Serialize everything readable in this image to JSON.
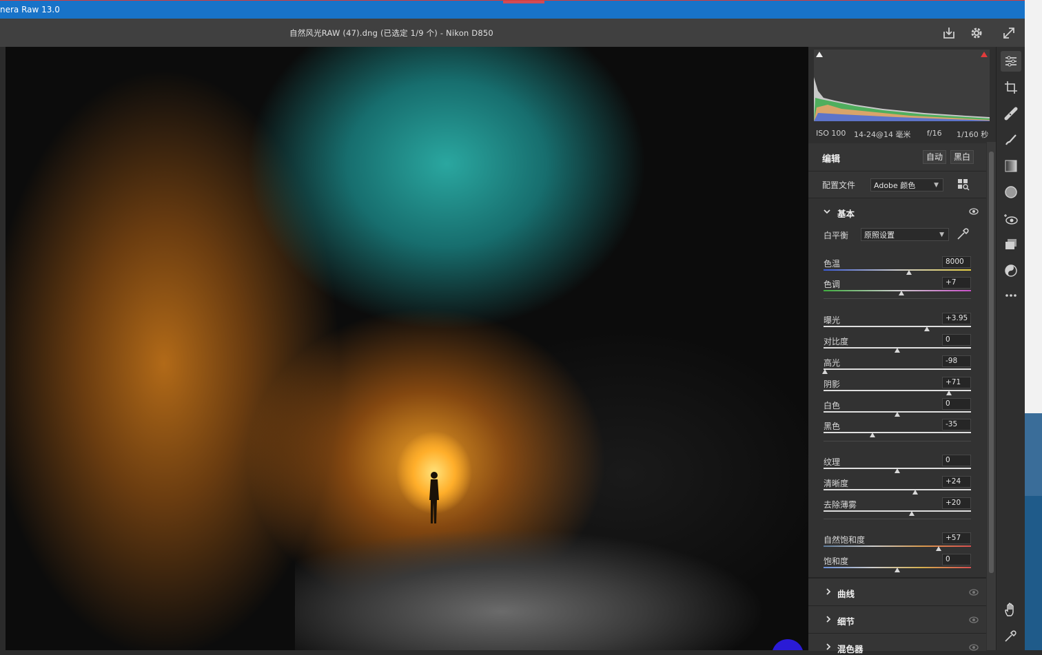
{
  "window": {
    "title": "nera Raw 13.0"
  },
  "header": {
    "file_title": "自然风光RAW (47).dng (已选定 1/9 个) - Nikon D850"
  },
  "meta": {
    "iso": "ISO 100",
    "lens": "14-24@14 毫米",
    "aperture": "f/16",
    "shutter": "1/160 秒"
  },
  "edit": {
    "title": "编辑",
    "auto_label": "自动",
    "bw_label": "黑白",
    "profile_label": "配置文件",
    "profile_value": "Adobe 颜色"
  },
  "basic": {
    "title": "基本",
    "wb_label": "白平衡",
    "wb_value": "原照设置",
    "sliders": [
      {
        "label": "色温",
        "value": "8000",
        "pos": 0.58
      },
      {
        "label": "色调",
        "value": "+7",
        "pos": 0.53
      },
      {
        "label": "曝光",
        "value": "+3.95",
        "pos": 0.7
      },
      {
        "label": "对比度",
        "value": "0",
        "pos": 0.5
      },
      {
        "label": "高光",
        "value": "-98",
        "pos": 0.01
      },
      {
        "label": "阴影",
        "value": "+71",
        "pos": 0.85
      },
      {
        "label": "白色",
        "value": "0",
        "pos": 0.5
      },
      {
        "label": "黑色",
        "value": "-35",
        "pos": 0.33
      },
      {
        "label": "纹理",
        "value": "0",
        "pos": 0.5
      },
      {
        "label": "清晰度",
        "value": "+24",
        "pos": 0.62
      },
      {
        "label": "去除薄雾",
        "value": "+20",
        "pos": 0.6
      },
      {
        "label": "自然饱和度",
        "value": "+57",
        "pos": 0.78
      },
      {
        "label": "饱和度",
        "value": "0",
        "pos": 0.5
      }
    ]
  },
  "sections": {
    "curve": "曲线",
    "detail": "细节",
    "mixer": "混色器"
  },
  "colors": {
    "titlebar": "#1873c8",
    "panel": "#2f2f2f",
    "section": "#353535"
  }
}
